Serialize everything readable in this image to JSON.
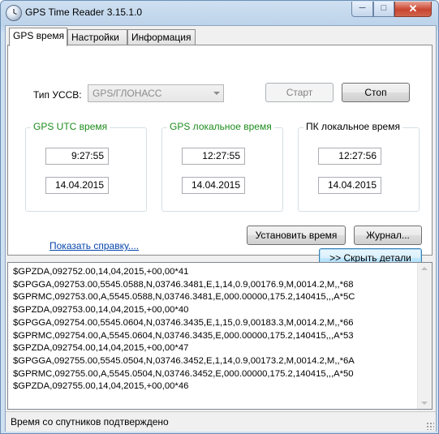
{
  "window": {
    "title": "GPS Time Reader 3.15.1.0"
  },
  "titlebar": {
    "minimize": "─",
    "maximize": "□",
    "close": "✕"
  },
  "tabs": [
    {
      "label": "GPS время",
      "active": true
    },
    {
      "label": "Настройки",
      "active": false
    },
    {
      "label": "Информация",
      "active": false
    }
  ],
  "gnss": {
    "label": "Тип УССВ:",
    "value": "GPS/ГЛОНАСС"
  },
  "buttons": {
    "start": "Старт",
    "stop": "Стоп",
    "set_time": "Установить время",
    "journal": "Журнал...",
    "hide_details": ">> Скрыть детали"
  },
  "groups": {
    "utc": {
      "title": "GPS UTC время",
      "time": "9:27:55",
      "date": "14.04.2015",
      "title_color": "#1d8c1d"
    },
    "gps_local": {
      "title": "GPS локальное время",
      "time": "12:27:55",
      "date": "14.04.2015",
      "title_color": "#1d8c1d"
    },
    "pc_local": {
      "title": "ПК локальное время",
      "time": "12:27:56",
      "date": "14.04.2015"
    }
  },
  "help_link": "Показать справку....",
  "log_lines": [
    "$GPZDA,092752.00,14,04,2015,+00,00*41",
    "$GPGGA,092753.00,5545.0588,N,03746.3481,E,1,14,0.9,00176.9,M,0014.2,M,,*68",
    "$GPRMC,092753.00,A,5545.0588,N,03746.3481,E,000.00000,175.2,140415,,,A*5C",
    "$GPZDA,092753.00,14,04,2015,+00,00*40",
    "$GPGGA,092754.00,5545.0604,N,03746.3435,E,1,15,0.9,00183.3,M,0014.2,M,,*66",
    "$GPRMC,092754.00,A,5545.0604,N,03746.3435,E,000.00000,175.2,140415,,,A*53",
    "$GPZDA,092754.00,14,04,2015,+00,00*47",
    "$GPGGA,092755.00,5545.0504,N,03746.3452,E,1,14,0.9,00173.2,M,0014.2,M,,*6A",
    "$GPRMC,092755.00,A,5545.0504,N,03746.3452,E,000.00000,175.2,140415,,,A*50",
    "$GPZDA,092755.00,14,04,2015,+00,00*46"
  ],
  "status": "Время со спутников подтверждено"
}
